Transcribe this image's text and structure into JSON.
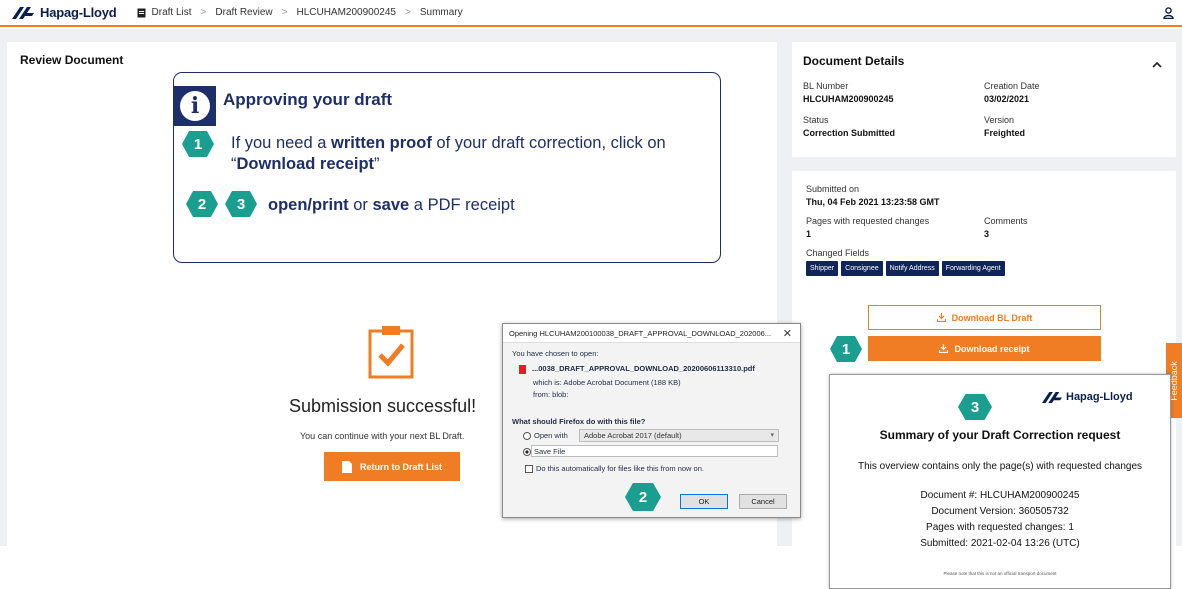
{
  "header": {
    "brand": "Hapag-Lloyd",
    "breadcrumbs": [
      "Draft List",
      "Draft Review",
      "HLCUHAM200900245",
      "Summary"
    ]
  },
  "colors": {
    "accent_orange": "#f07c23",
    "navy": "#1d2f6b",
    "teal_badge": "#1a9e8f",
    "chip_navy": "#0f2459"
  },
  "main": {
    "title": "Review Document",
    "success_title": "Submission successful!",
    "success_sub": "You can continue with your next BL Draft.",
    "return_button": "Return to Draft List"
  },
  "callout": {
    "title": "Approving your draft",
    "step1_badge": "1",
    "step1_a": "If you need a ",
    "step1_b": "written proof",
    "step1_c": " of your draft correction, click on “",
    "step1_d": "Download receipt",
    "step1_e": "”",
    "step2_badge": "2",
    "step3_badge": "3",
    "step2_a": "open/print",
    "step2_b": " or ",
    "step2_c": "save",
    "step2_d": " a PDF receipt"
  },
  "details": {
    "title": "Document Details",
    "bl_number_label": "BL Number",
    "bl_number": "HLCUHAM200900245",
    "creation_date_label": "Creation Date",
    "creation_date": "03/02/2021",
    "status_label": "Status",
    "status": "Correction Submitted",
    "version_label": "Version",
    "version": "Freighted"
  },
  "submission": {
    "submitted_label": "Submitted on",
    "submitted_value": "Thu, 04 Feb 2021 13:23:58 GMT",
    "pages_label": "Pages with requested changes",
    "pages_value": "1",
    "comments_label": "Comments",
    "comments_value": "3",
    "changed_fields_label": "Changed Fields",
    "changed_fields": [
      "Shipper",
      "Consignee",
      "Notify Address",
      "Forwarding Agent"
    ],
    "download_draft": "Download BL Draft",
    "download_receipt": "Download receipt",
    "badge": "1"
  },
  "feedback": "Feedback",
  "dialog": {
    "title": "Opening HLCUHAM200100038_DRAFT_APPROVAL_DOWNLOAD_202006...",
    "chosen": "You have chosen to open:",
    "filename": "...0038_DRAFT_APPROVAL_DOWNLOAD_20200606113310.pdf",
    "which_is": "which is: Adobe Acrobat Document (188 KB)",
    "from": "from: blob:",
    "question": "What should Firefox do with this file?",
    "open_with": "Open with",
    "open_with_app": "Adobe Acrobat 2017  (default)",
    "save_file": "Save File",
    "auto": "Do this automatically for files like this from now on.",
    "ok": "OK",
    "cancel": "Cancel",
    "badge": "2"
  },
  "receipt": {
    "badge": "3",
    "brand": "Hapag-Lloyd",
    "title": "Summary of your Draft Correction request",
    "overview": "This overview contains only the page(s) with requested changes",
    "doc_number": "Document #: HLCUHAM200900245",
    "doc_version": "Document Version: 360505732",
    "pages": "Pages with requested changes: 1",
    "submitted": "Submitted: 2021-02-04 13:26 (UTC)",
    "note": "Please note that this is not an official transport document"
  }
}
